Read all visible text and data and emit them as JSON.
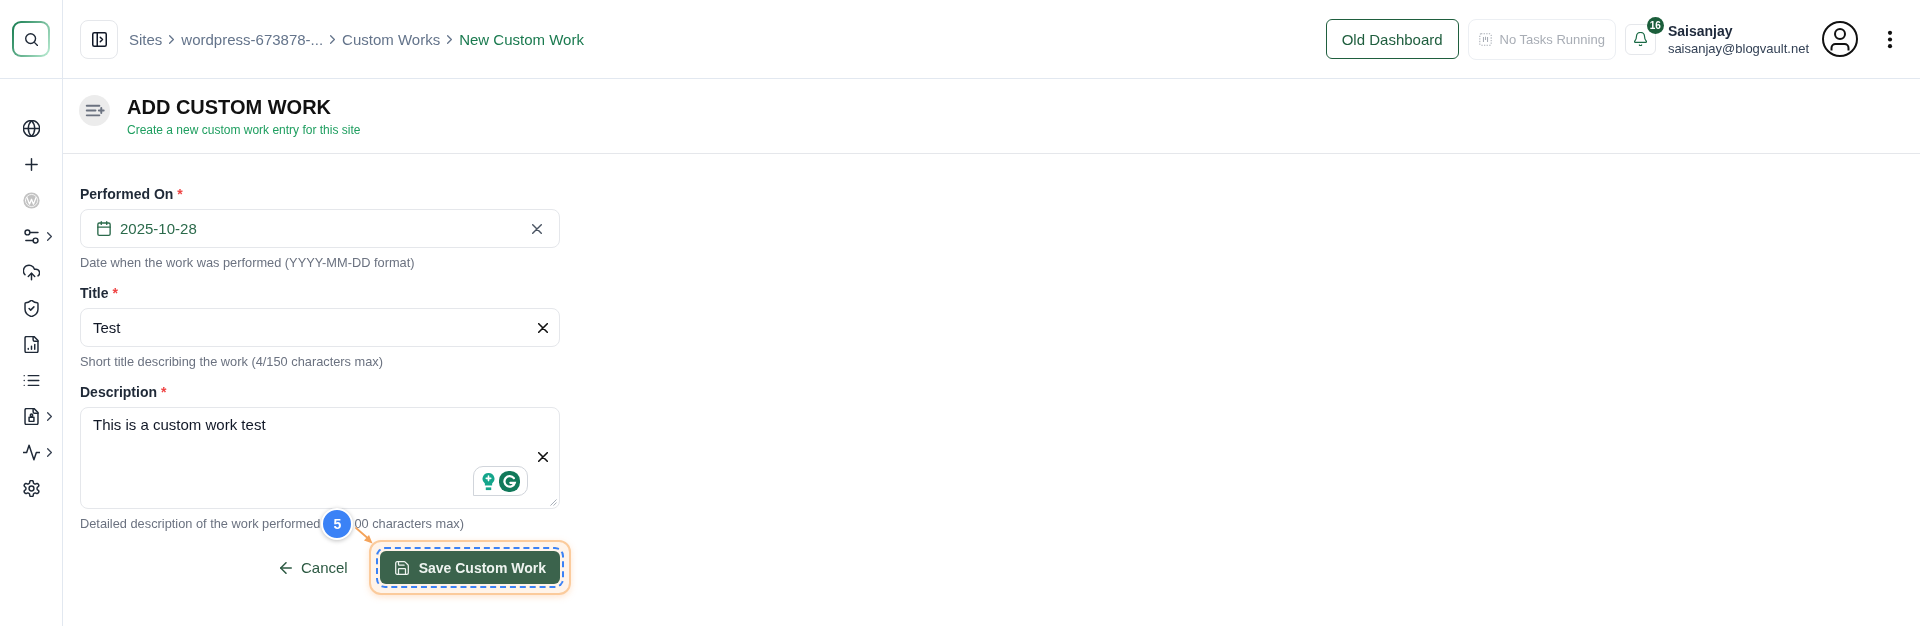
{
  "sidebar": {
    "items": [
      {
        "kind": "globe",
        "submenu": false,
        "disabled": false
      },
      {
        "kind": "plus",
        "submenu": false,
        "disabled": false
      },
      {
        "kind": "wordpress",
        "submenu": false,
        "disabled": true
      },
      {
        "kind": "sliders",
        "submenu": true,
        "disabled": false
      },
      {
        "kind": "cloud-upload",
        "submenu": false,
        "disabled": false
      },
      {
        "kind": "shield",
        "submenu": false,
        "disabled": false
      },
      {
        "kind": "report",
        "submenu": false,
        "disabled": false
      },
      {
        "kind": "list",
        "submenu": false,
        "disabled": false
      },
      {
        "kind": "document",
        "submenu": true,
        "disabled": false
      },
      {
        "kind": "pulse",
        "submenu": true,
        "disabled": false
      },
      {
        "kind": "gear",
        "submenu": false,
        "disabled": false
      }
    ]
  },
  "topbar": {
    "breadcrumbs": [
      {
        "label": "Sites",
        "selected": false
      },
      {
        "label": "wordpress-673878-...",
        "selected": false
      },
      {
        "label": "Custom Works",
        "selected": false
      },
      {
        "label": "New Custom Work",
        "selected": true
      }
    ],
    "old_dashboard": "Old Dashboard",
    "tasks": {
      "label": "No Tasks Running",
      "disabled": true
    },
    "notifications": {
      "count": "16"
    },
    "user": {
      "name": "Saisanjay",
      "email": "saisanjay@blogvault.net"
    }
  },
  "header": {
    "title": "ADD CUSTOM WORK",
    "subtitle": "Create a new custom work entry for this site"
  },
  "form": {
    "fields": [
      {
        "kind": "date",
        "label": "Performed On",
        "required_mark": "*",
        "value": "2025-10-28",
        "helper": "Date when the work was performed (YYYY-MM-DD format)"
      },
      {
        "kind": "text",
        "label": "Title",
        "required_mark": "*",
        "value": "Test",
        "helper": "Short title describing the work (4/150 characters max)"
      },
      {
        "kind": "textarea",
        "label": "Description",
        "required_mark": "*",
        "value": "This is a custom work test",
        "helper": "Detailed description of the work performed",
        "helper_tail": "00 characters max)"
      }
    ],
    "cancel": "Cancel",
    "save": "Save Custom Work"
  },
  "annotation": {
    "step": "5"
  }
}
